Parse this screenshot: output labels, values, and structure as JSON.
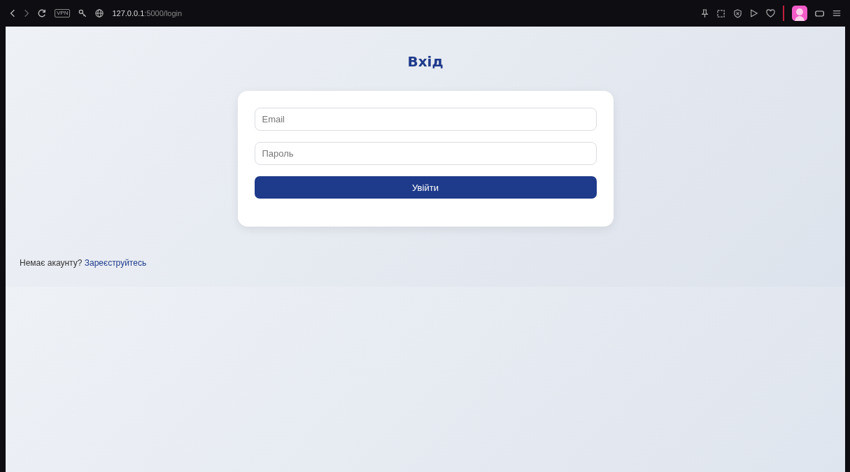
{
  "browser": {
    "vpn_badge": "VPN",
    "url_host": "127.0.0.1",
    "url_rest": ":5000/login"
  },
  "page": {
    "title": "Вхід",
    "fields": [
      {
        "placeholder": "Email"
      },
      {
        "placeholder": "Пароль"
      }
    ],
    "submit": "Увійти",
    "footer_text": "Немає акаунту?",
    "footer_link": "Зареєструйтесь"
  }
}
